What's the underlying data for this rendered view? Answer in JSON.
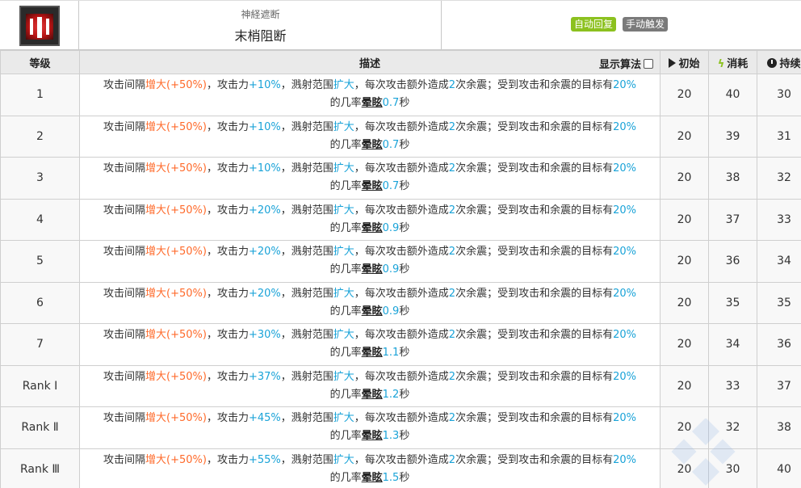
{
  "skill": {
    "sub_title": "神経遮断",
    "name": "末梢阻断",
    "tags": [
      "自动回复",
      "手动触发"
    ]
  },
  "table": {
    "headers": {
      "level": "等级",
      "desc": "描述",
      "algo_label": "显示算法",
      "initial": "初始",
      "cost": "消耗",
      "duration": "持续"
    },
    "rows": [
      {
        "level": "1",
        "atk": "+10%",
        "stun": "0.7",
        "initial": "20",
        "cost": "40",
        "duration": "30"
      },
      {
        "level": "2",
        "atk": "+10%",
        "stun": "0.7",
        "initial": "20",
        "cost": "39",
        "duration": "31"
      },
      {
        "level": "3",
        "atk": "+10%",
        "stun": "0.7",
        "initial": "20",
        "cost": "38",
        "duration": "32"
      },
      {
        "level": "4",
        "atk": "+20%",
        "stun": "0.9",
        "initial": "20",
        "cost": "37",
        "duration": "33"
      },
      {
        "level": "5",
        "atk": "+20%",
        "stun": "0.9",
        "initial": "20",
        "cost": "36",
        "duration": "34"
      },
      {
        "level": "6",
        "atk": "+20%",
        "stun": "0.9",
        "initial": "20",
        "cost": "35",
        "duration": "35"
      },
      {
        "level": "7",
        "atk": "+30%",
        "stun": "1.1",
        "initial": "20",
        "cost": "34",
        "duration": "36"
      },
      {
        "level": "Rank Ⅰ",
        "atk": "+37%",
        "stun": "1.2",
        "initial": "20",
        "cost": "33",
        "duration": "37"
      },
      {
        "level": "Rank Ⅱ",
        "atk": "+45%",
        "stun": "1.3",
        "initial": "20",
        "cost": "32",
        "duration": "38"
      },
      {
        "level": "Rank Ⅲ",
        "atk": "+55%",
        "stun": "1.5",
        "initial": "20",
        "cost": "30",
        "duration": "40"
      }
    ],
    "desc_parts": {
      "p1": "攻击间隔",
      "interval": "增大(+50%)",
      "p2": "，攻击力",
      "p3": "，溅射范围",
      "range": "扩大",
      "p4": "，每次攻击额外造成",
      "quakes": "2",
      "p5": "次余震；受到攻击和余震的目标有",
      "chance": "20%",
      "p6": "的几率",
      "stun_word": "晕眩",
      "p7": "秒"
    }
  },
  "colors": {
    "increase": "#ff6a2a",
    "value": "#1aa3d8",
    "tag_auto": "#8cc11f",
    "tag_manual": "#7a7a7a"
  }
}
